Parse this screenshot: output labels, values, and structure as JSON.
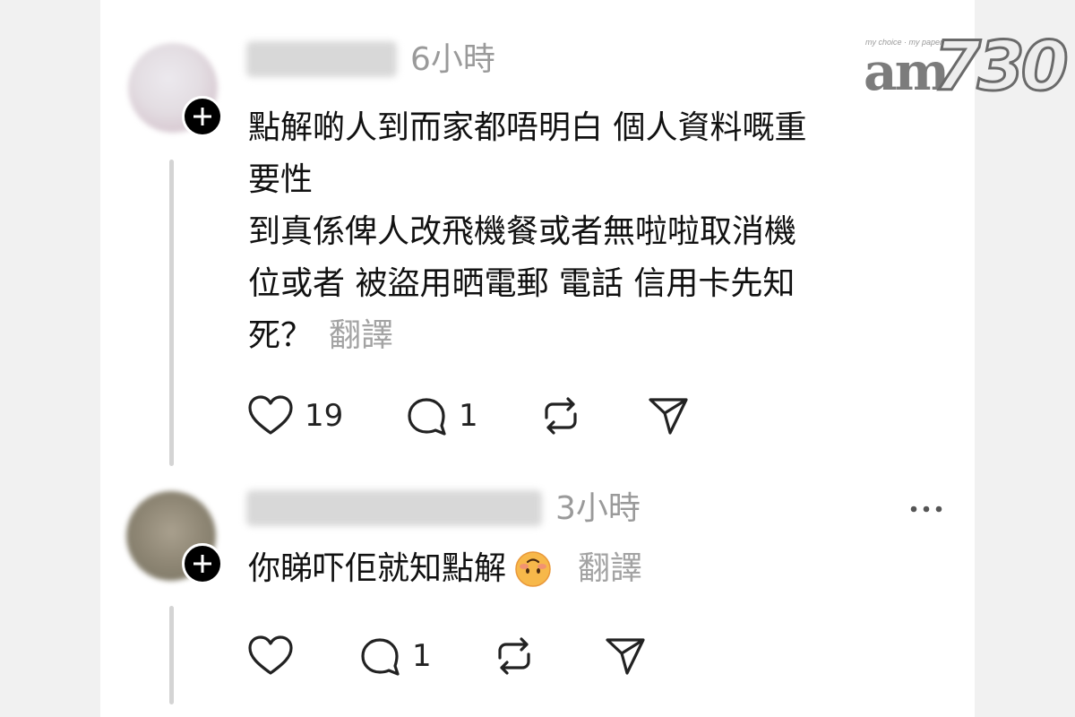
{
  "logo": {
    "tagline": "my choice · my paper",
    "brand_am": "am",
    "brand_num": "730"
  },
  "comments": [
    {
      "time": "6小時",
      "lines": [
        "點解啲人到而家都唔明白 個人資料嘅重",
        "要性",
        "到真係俾人改飛機餐或者無啦啦取消機",
        "位或者 被盜用晒電郵 電話 信用卡先知",
        "死？"
      ],
      "translate_label": "翻譯",
      "likes": "19",
      "replies": "1"
    },
    {
      "time": "3小時",
      "text": "你睇吓佢就知點解",
      "emoji": "upside-down-face-emoji",
      "translate_label": "翻譯",
      "likes": "",
      "replies": "1"
    }
  ],
  "icons": {
    "like": "heart-icon",
    "reply": "speech-bubble-icon",
    "repost": "repost-icon",
    "share": "send-icon",
    "more": "more-dots-icon",
    "follow": "plus-icon"
  },
  "colors": {
    "text": "#111111",
    "muted": "#9a9a9a",
    "thread_line": "#d4d4d4",
    "follow_badge": "#000000"
  }
}
